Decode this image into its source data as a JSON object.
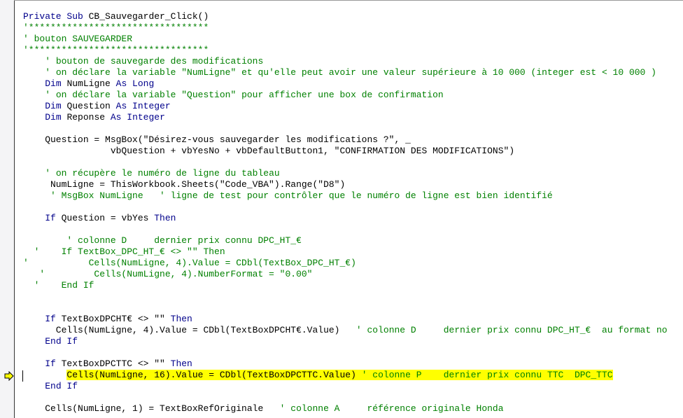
{
  "editor": {
    "execution_line_index": 32,
    "colors": {
      "keyword": "#00008b",
      "comment": "#008000",
      "text": "#000000",
      "highlight": "#ffff00"
    },
    "lines": [
      [
        [
          "kw",
          "Private Sub "
        ],
        [
          "tx",
          "CB_Sauvegarder_Click()"
        ]
      ],
      [
        [
          "cm",
          "'*********************************"
        ]
      ],
      [
        [
          "cm",
          "' bouton SAUVEGARDER"
        ]
      ],
      [
        [
          "cm",
          "'*********************************"
        ]
      ],
      [
        [
          "tx",
          "    "
        ],
        [
          "cm",
          "' bouton de sauvegarde des modifications"
        ]
      ],
      [
        [
          "tx",
          "    "
        ],
        [
          "cm",
          "' on déclare la variable \"NumLigne\" et qu'elle peut avoir une valeur supérieure à 10 000 (integer est < 10 000 )"
        ]
      ],
      [
        [
          "tx",
          "    "
        ],
        [
          "kw",
          "Dim "
        ],
        [
          "tx",
          "NumLigne "
        ],
        [
          "kw",
          "As Long"
        ]
      ],
      [
        [
          "tx",
          "    "
        ],
        [
          "cm",
          "' on déclare la variable \"Question\" pour afficher une box de confirmation"
        ]
      ],
      [
        [
          "tx",
          "    "
        ],
        [
          "kw",
          "Dim "
        ],
        [
          "tx",
          "Question "
        ],
        [
          "kw",
          "As Integer"
        ]
      ],
      [
        [
          "tx",
          "    "
        ],
        [
          "kw",
          "Dim "
        ],
        [
          "tx",
          "Reponse "
        ],
        [
          "kw",
          "As Integer"
        ]
      ],
      [],
      [
        [
          "tx",
          "    Question = MsgBox(\"Désirez-vous sauvegarder les modifications ?\", _"
        ]
      ],
      [
        [
          "tx",
          "                vbQuestion + vbYesNo + vbDefaultButton1, \"CONFIRMATION DES MODIFICATIONS\")"
        ]
      ],
      [],
      [
        [
          "tx",
          "    "
        ],
        [
          "cm",
          "' on récupère le numéro de ligne du tableau"
        ]
      ],
      [
        [
          "tx",
          "     NumLigne = ThisWorkbook.Sheets(\"Code_VBA\").Range(\"D8\")"
        ]
      ],
      [
        [
          "tx",
          "     "
        ],
        [
          "cm",
          "' MsgBox NumLigne   ' ligne de test pour contrôler que le numéro de ligne est bien identifié"
        ]
      ],
      [],
      [
        [
          "tx",
          "    "
        ],
        [
          "kw",
          "If "
        ],
        [
          "tx",
          "Question = vbYes "
        ],
        [
          "kw",
          "Then"
        ]
      ],
      [],
      [
        [
          "tx",
          "        "
        ],
        [
          "cm",
          "' colonne D     dernier prix connu DPC_HT_€"
        ]
      ],
      [
        [
          "cm",
          "  '    If TextBox_DPC_HT_€ <> \"\" Then"
        ]
      ],
      [
        [
          "cm",
          "'           Cells(NumLigne, 4).Value = CDbl(TextBox_DPC_HT_€)"
        ]
      ],
      [
        [
          "cm",
          "   '         Cells(NumLigne, 4).NumberFormat = \"0.00\""
        ]
      ],
      [
        [
          "cm",
          "  '    End If"
        ]
      ],
      [],
      [],
      [
        [
          "tx",
          "    "
        ],
        [
          "kw",
          "If "
        ],
        [
          "tx",
          "TextBoxDPCHT€ <> \"\" "
        ],
        [
          "kw",
          "Then"
        ]
      ],
      [
        [
          "tx",
          "      Cells(NumLigne, 4).Value = CDbl(TextBoxDPCHT€.Value)   "
        ],
        [
          "cm",
          "' colonne D     dernier prix connu DPC_HT_€  au format no"
        ]
      ],
      [
        [
          "tx",
          "    "
        ],
        [
          "kw",
          "End If"
        ]
      ],
      [],
      [
        [
          "tx",
          "    "
        ],
        [
          "kw",
          "If "
        ],
        [
          "tx",
          "TextBoxDPCTTC <> \"\" "
        ],
        [
          "kw",
          "Then"
        ]
      ],
      [
        [
          "tx",
          "        "
        ],
        [
          "hl",
          "Cells(NumLigne, 16).Value = CDbl(TextBoxDPCTTC.Value) "
        ],
        [
          "hlc",
          "' colonne P    dernier prix connu TTC  DPC_TTC"
        ]
      ],
      [
        [
          "tx",
          "    "
        ],
        [
          "kw",
          "End If"
        ]
      ],
      [],
      [
        [
          "tx",
          "    Cells(NumLigne, 1) = TextBoxRefOriginale   "
        ],
        [
          "cm",
          "' colonne A     référence originale Honda"
        ]
      ]
    ]
  }
}
